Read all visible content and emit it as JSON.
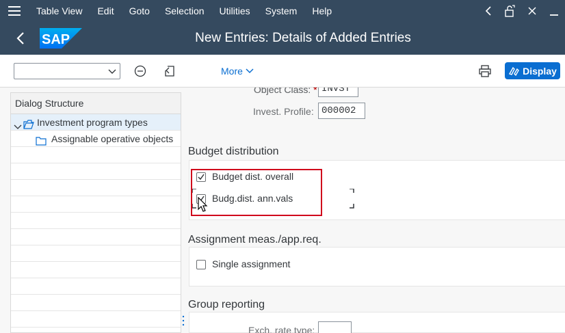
{
  "menubar": {
    "items": [
      "Table View",
      "Edit",
      "Goto",
      "Selection",
      "Utilities",
      "System",
      "Help"
    ]
  },
  "titlebar": {
    "logo_text": "SAP",
    "title": "New Entries: Details of Added Entries"
  },
  "toolbar": {
    "more_label": "More",
    "display_label": "Display"
  },
  "dialog_structure": {
    "header": "Dialog Structure",
    "items": [
      {
        "label": "Investment program types",
        "selected": true,
        "expanded": true,
        "level": 0
      },
      {
        "label": "Assignable operative objects",
        "selected": false,
        "level": 1
      }
    ]
  },
  "form": {
    "object_class_label": "Object Class:",
    "object_class_value": "INVST",
    "invest_profile_label": "Invest. Profile:",
    "invest_profile_value": "000002",
    "budget_section_title": "Budget distribution",
    "budget_dist_overall_label": "Budget dist. overall",
    "budget_dist_overall_checked": true,
    "budg_dist_ann_label": "Budg.dist. ann.vals",
    "budg_dist_ann_checked": true,
    "assignment_section_title": "Assignment meas./app.req.",
    "single_assignment_label": "Single assignment",
    "single_assignment_checked": false,
    "group_reporting_title": "Group reporting",
    "exch_rate_label": "Exch. rate type:",
    "exch_rate_value": ""
  },
  "colors": {
    "shell": "#354a5f",
    "accent": "#0a6ed1",
    "highlight_box": "#d0021b"
  }
}
